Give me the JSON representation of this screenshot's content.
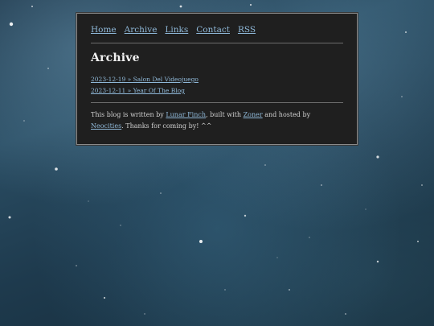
{
  "nav": {
    "items": [
      {
        "label": "Home"
      },
      {
        "label": "Archive"
      },
      {
        "label": "Links"
      },
      {
        "label": "Contact"
      },
      {
        "label": "RSS"
      }
    ]
  },
  "page": {
    "title": "Archive"
  },
  "posts": [
    {
      "label": "2023-12-19 » Salon Del Videojuego"
    },
    {
      "label": "2023-12-11 » Year Of The Blog"
    }
  ],
  "footer": {
    "text_1": "This blog is written by ",
    "author": "Lunar Finch",
    "text_2": ", built with ",
    "builder": "Zoner",
    "text_3": " and hosted by ",
    "host": "Neocities",
    "text_4": ". Thanks for coming by! ^^"
  },
  "colors": {
    "panel_background": "#1f1f1f",
    "link": "#8fb8d8",
    "text": "#d8d8d8",
    "page_background": "#1e3a4d"
  }
}
